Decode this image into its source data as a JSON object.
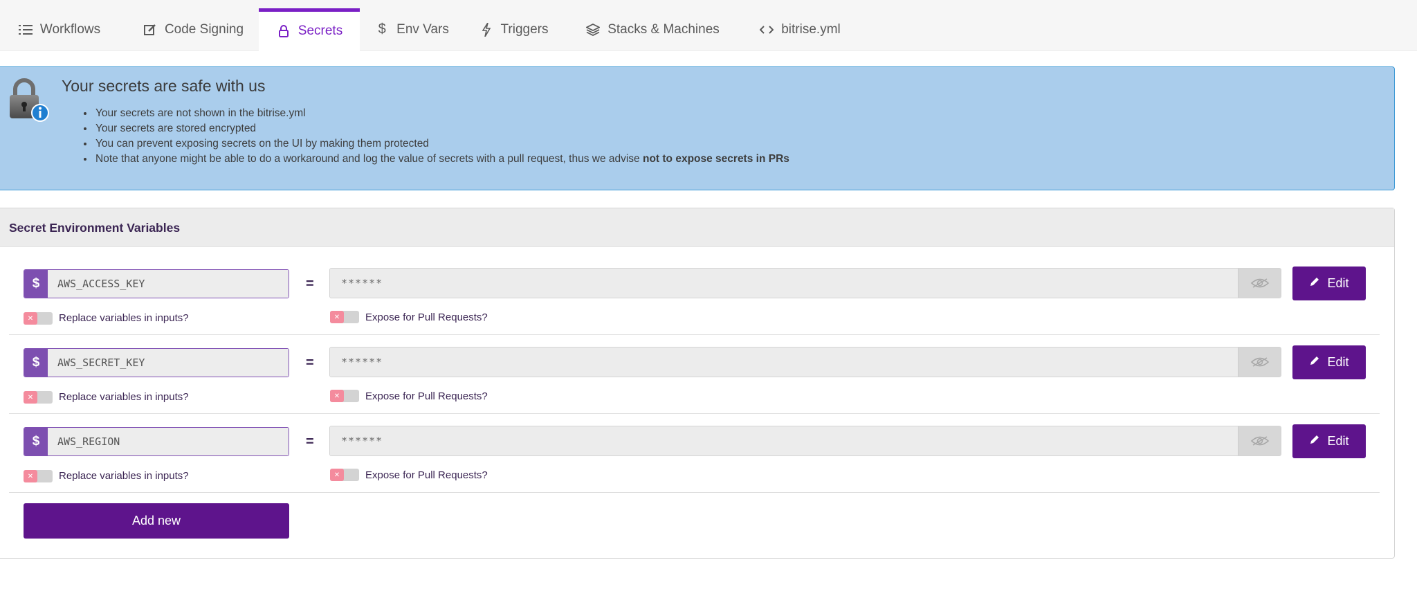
{
  "tabs": [
    {
      "label": "Workflows",
      "icon": "list-icon"
    },
    {
      "label": "Code Signing",
      "icon": "edit-box-icon"
    },
    {
      "label": "Secrets",
      "icon": "lock-icon",
      "active": true
    },
    {
      "label": "Env Vars",
      "icon": "dollar-icon"
    },
    {
      "label": "Triggers",
      "icon": "bolt-icon"
    },
    {
      "label": "Stacks & Machines",
      "icon": "layers-icon"
    },
    {
      "label": "bitrise.yml",
      "icon": "code-icon"
    }
  ],
  "banner": {
    "title": "Your secrets are safe with us",
    "items": [
      "Your secrets are not shown in the bitrise.yml",
      "Your secrets are stored encrypted",
      "You can prevent exposing secrets on the UI by making them protected"
    ],
    "last_item_prefix": "Note that anyone might be able to do a workaround and log the value of secrets with a pull request, thus we advise ",
    "last_item_bold": "not to expose secrets in PRs"
  },
  "panel": {
    "title": "Secret Environment Variables",
    "rows": [
      {
        "key": "AWS_ACCESS_KEY",
        "value": "******",
        "replace_label": "Replace variables in inputs?",
        "expose_label": "Expose for Pull Requests?",
        "edit_label": "Edit"
      },
      {
        "key": "AWS_SECRET_KEY",
        "value": "******",
        "replace_label": "Replace variables in inputs?",
        "expose_label": "Expose for Pull Requests?",
        "edit_label": "Edit"
      },
      {
        "key": "AWS_REGION",
        "value": "******",
        "replace_label": "Replace variables in inputs?",
        "expose_label": "Expose for Pull Requests?",
        "edit_label": "Edit"
      }
    ],
    "dollar_symbol": "$",
    "equals_symbol": "=",
    "add_new_label": "Add new"
  },
  "colors": {
    "accent": "#7a1fc5",
    "button": "#5e148c",
    "banner_bg": "#aacdec",
    "toggle_off": "#f48b9d"
  }
}
